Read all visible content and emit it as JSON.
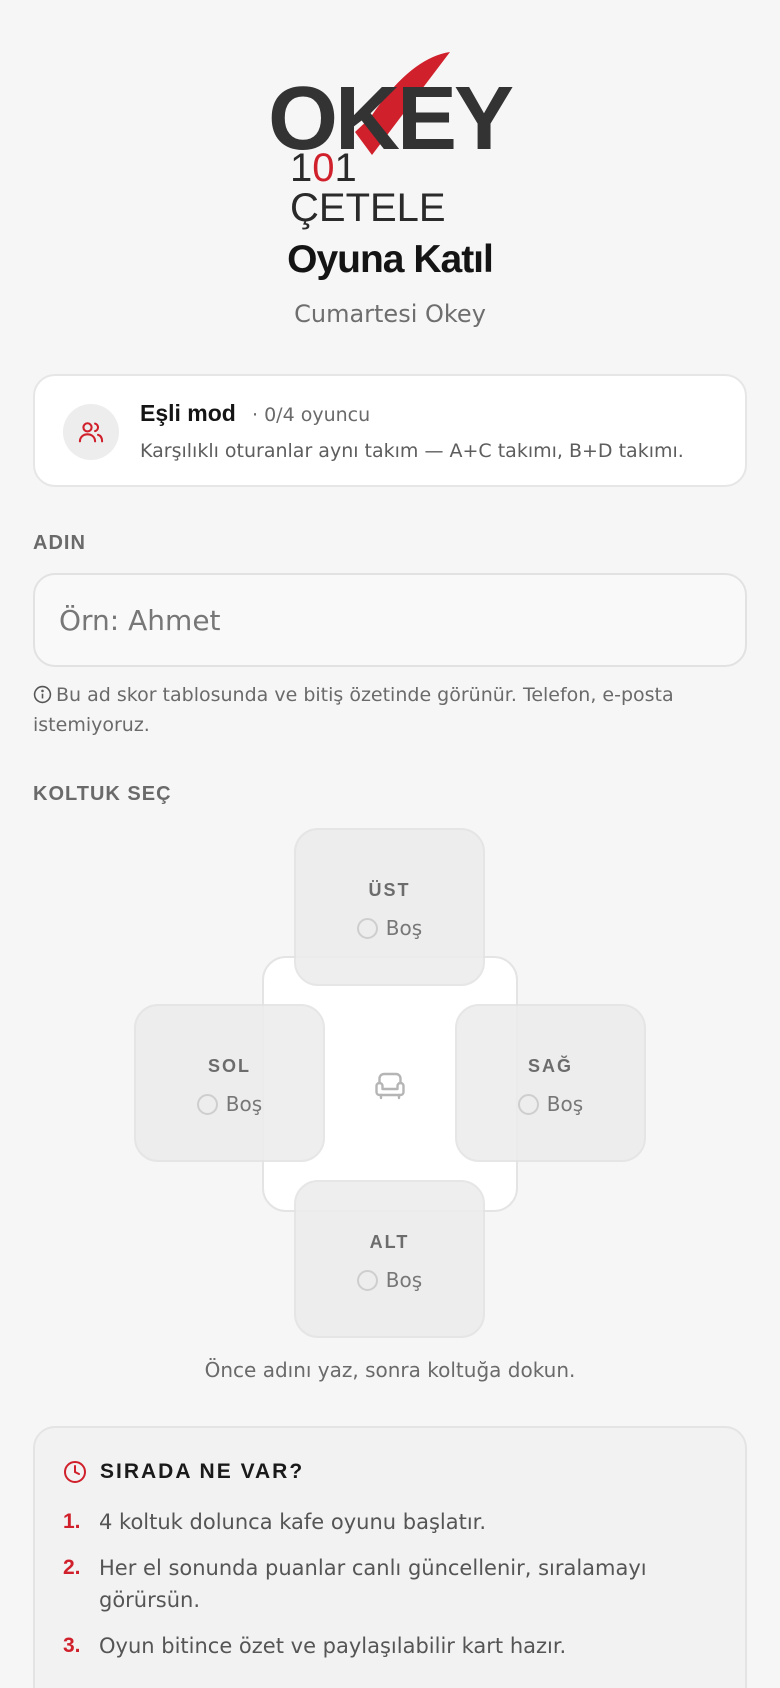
{
  "brand": {
    "logo_word": "OKEY",
    "logo_sub_prefix": "1",
    "logo_sub_red": "0",
    "logo_sub_suffix": "1 ÇETELE",
    "accent_color": "#d0202b"
  },
  "page": {
    "title": "Oyuna Katıl",
    "subtitle": "Cumartesi Okey"
  },
  "mode": {
    "icon": "users-icon",
    "title": "Eşli mod",
    "count": "· 0/4 oyuncu",
    "description": "Karşılıklı oturanlar aynı takım — A+C takımı, B+D takımı."
  },
  "name_field": {
    "label": "ADIN",
    "value": "",
    "placeholder": "Örn: Ahmet",
    "hint": "Bu ad skor tablosunda ve bitiş özetinde görünür. Telefon, e-posta istemiyoruz."
  },
  "seats": {
    "label": "KOLTUK SEÇ",
    "top": {
      "name": "ÜST",
      "status": "Boş"
    },
    "left": {
      "name": "SOL",
      "status": "Boş"
    },
    "right": {
      "name": "SAĞ",
      "status": "Boş"
    },
    "bottom": {
      "name": "ALT",
      "status": "Boş"
    },
    "table_icon": "armchair-icon",
    "hint": "Önce adını yaz, sonra koltuğa dokun."
  },
  "next": {
    "icon": "clock-icon",
    "title": "SIRADA NE VAR?",
    "steps": [
      {
        "num": "1.",
        "text": "4 koltuk dolunca kafe oyunu başlatır."
      },
      {
        "num": "2.",
        "text": "Her el sonunda puanlar canlı güncellenir, sıralamayı görürsün."
      },
      {
        "num": "3.",
        "text": "Oyun bitince özet ve paylaşılabilir kart hazır."
      }
    ]
  }
}
